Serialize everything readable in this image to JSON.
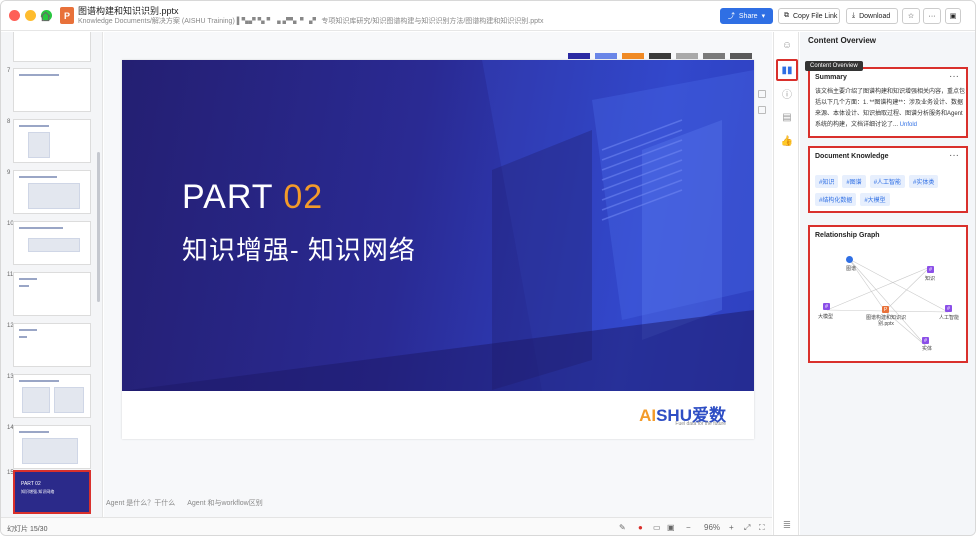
{
  "window": {
    "title": "图谱构建和知识识别.pptx",
    "path": "Knowledge Documents/解决方案 (AISHU Training) ▌▚▞ ▚ ▘▗ ▞▚▝ ▗▘ 专项知识库研究/知识图谱构建与知识识别方法/图谱构建和知识识别.pptx"
  },
  "toolbar": {
    "share_label": "Share",
    "copy_label": "Copy File Link",
    "download_label": "Download",
    "more_label": "···"
  },
  "thumbnails": [
    {
      "num": "7"
    },
    {
      "num": "8"
    },
    {
      "num": "9"
    },
    {
      "num": "10"
    },
    {
      "num": "11"
    },
    {
      "num": "12"
    },
    {
      "num": "13"
    },
    {
      "num": "14"
    },
    {
      "num": "15"
    }
  ],
  "thumb_selected": {
    "line1": "PART 02",
    "line2": "知识增强-知识网络"
  },
  "slide": {
    "part_label": "PART ",
    "part_num": "02",
    "subtitle": "知识增强- 知识网络",
    "logo_a": "AI",
    "logo_b": "SHU",
    "logo_cn": "爱数",
    "logo_tag": "Fuel data for the future"
  },
  "swatch_colors": [
    "#2b2aa3",
    "#6a86e8",
    "#f08a24",
    "#3a3a3a",
    "#a9a9a9",
    "#7a7a7a",
    "#5a5a5a"
  ],
  "notes": [
    "Agent 是什么？干什么",
    "Agent 和与workflow区别"
  ],
  "status": {
    "slide_counter": "幻灯片 15/30",
    "zoom": "96%"
  },
  "rail": {
    "tooltip": "Content Overview"
  },
  "panel": {
    "title": "Content Overview",
    "summary": {
      "heading": "Summary",
      "text": "该文档主要介绍了图谱构建和知识增强相关内容，重点包括以下几个方面：1. **图谱构建**：涉及业务设计、数据来源、本体设计、知识抽取过程、图谱分析服务和Agent系统的构建，文档详细讨论了... ",
      "unfold": "Unfold"
    },
    "knowledge": {
      "heading": "Document Knowledge",
      "tags": [
        "#知识",
        "#图谱",
        "#人工智能",
        "#实体类",
        "#结构化数据",
        "#大模型"
      ]
    },
    "graph": {
      "heading": "Relationship Graph",
      "center_label": "图谱构建和知识识别.pptx",
      "labels": [
        "图谱",
        "知识",
        "大模型",
        "人工智能",
        "实体"
      ]
    }
  }
}
